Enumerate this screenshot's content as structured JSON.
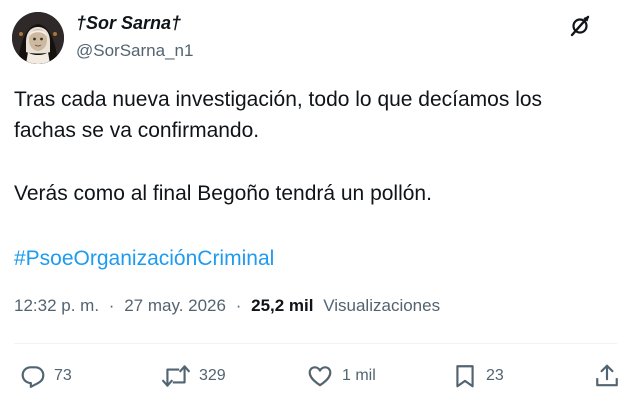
{
  "author": {
    "display_name": "†Sor Sarna†",
    "handle": "@SorSarna_n1"
  },
  "tweet": {
    "line1": "Tras cada nueva investigación, todo lo que decíamos los",
    "line2": "fachas se va confirmando.",
    "line3": "Verás como al final Begoño tendrá un pollón.",
    "hashtag": "#PsoeOrganizaciónCriminal"
  },
  "meta": {
    "time": "12:32 p. m.",
    "separator": "·",
    "date": "27 may. 2026",
    "views_count": "25,2 mil",
    "views_label": "Visualizaciones"
  },
  "actions": {
    "replies": "73",
    "reposts": "329",
    "likes": "1 mil",
    "bookmarks": "23"
  },
  "icons": {
    "more": "grok-slash-icon",
    "reply": "reply-icon",
    "repost": "repost-icon",
    "like": "heart-icon",
    "bookmark": "bookmark-icon",
    "share": "share-icon"
  },
  "colors": {
    "text": "#0f1419",
    "secondary": "#536471",
    "link": "#1d9bf0",
    "divider": "#eff3f4"
  }
}
